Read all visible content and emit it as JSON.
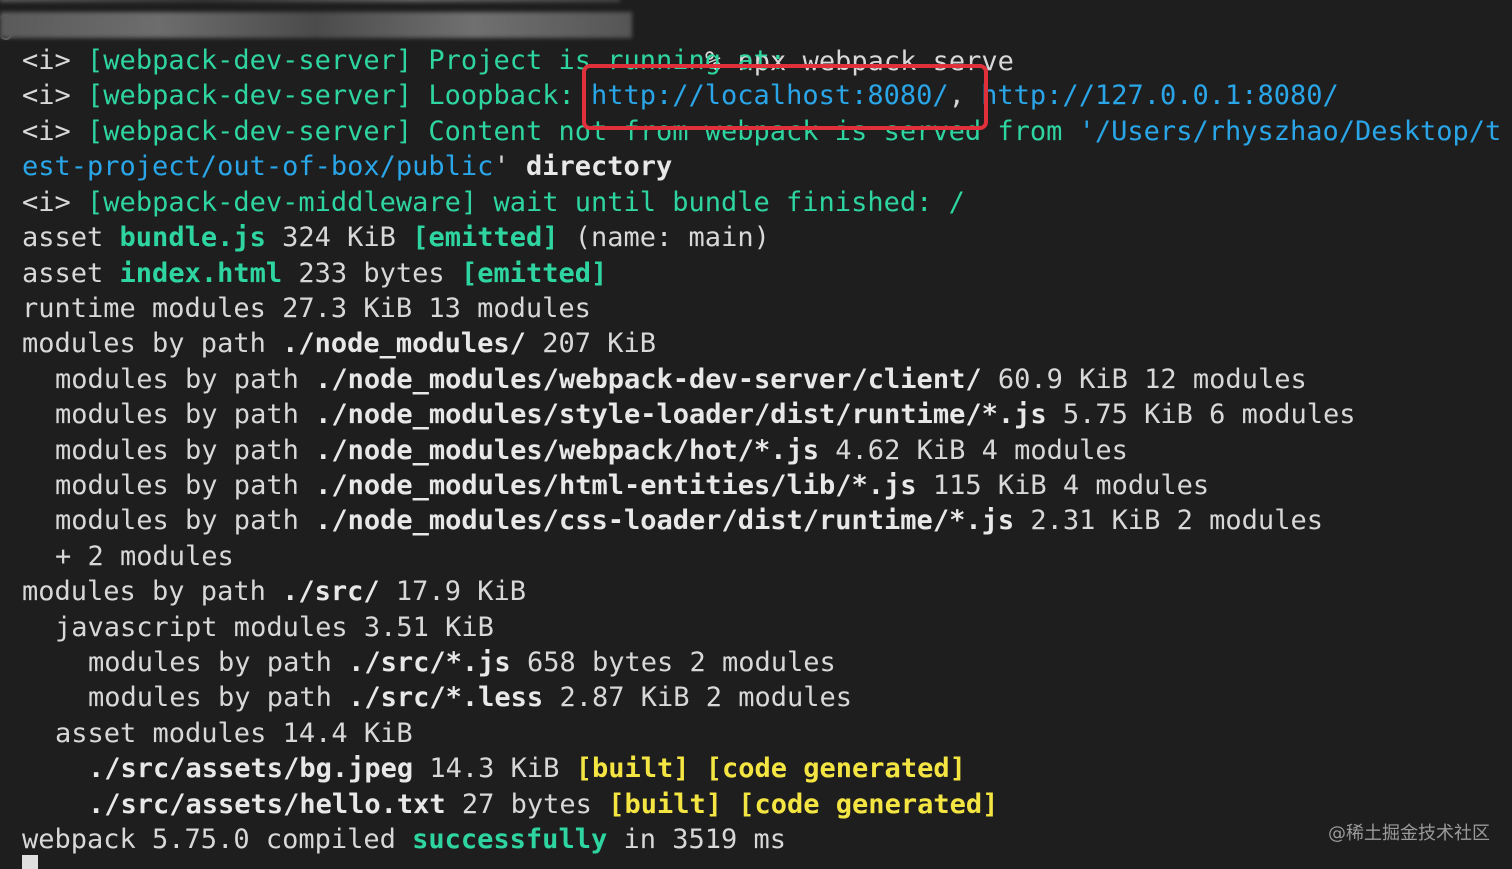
{
  "command": "% npx webpack serve",
  "lines": {
    "l1": {
      "tag": "<i>",
      "src": "[webpack-dev-server]",
      "msg": "Project is running at:"
    },
    "l2": {
      "tag": "<i>",
      "src": "[webpack-dev-server]",
      "msg": "Loopback:",
      "url1": "http://localhost:8080/",
      "sep": ",",
      "url2": "http://127.0.0.1:8080/"
    },
    "l3": {
      "tag": "<i>",
      "src": "[webpack-dev-server]",
      "msg": "Content not from webpack is served from",
      "path_a": "'/Users/rhyszhao/Desktop/t",
      "path_b": "est-project/out-of-box/public",
      "quote": "'",
      "tail": "directory"
    },
    "l4": {
      "tag": "<i>",
      "src": "[webpack-dev-middleware]",
      "msg": "wait until bundle finished: /"
    },
    "l5": {
      "a": "asset",
      "file": "bundle.js",
      "size": "324 KiB",
      "status": "[emitted]",
      "extra": "(name: main)"
    },
    "l6": {
      "a": "asset",
      "file": "index.html",
      "size": "233 bytes",
      "status": "[emitted]"
    },
    "l7": {
      "text": "runtime modules 27.3 KiB 13 modules"
    },
    "l8": {
      "pre": "modules by path",
      "path": "./node_modules/",
      "post": "207 KiB"
    },
    "l9": {
      "pre": "modules by path",
      "path": "./node_modules/webpack-dev-server/client/",
      "post": "60.9 KiB 12 modules"
    },
    "l10": {
      "pre": "modules by path",
      "path": "./node_modules/style-loader/dist/runtime/*.js",
      "post": "5.75 KiB 6 modules"
    },
    "l11": {
      "pre": "modules by path",
      "path": "./node_modules/webpack/hot/*.js",
      "post": "4.62 KiB 4 modules"
    },
    "l12": {
      "pre": "modules by path",
      "path": "./node_modules/html-entities/lib/*.js",
      "post": "115 KiB 4 modules"
    },
    "l13": {
      "pre": "modules by path",
      "path": "./node_modules/css-loader/dist/runtime/*.js",
      "post": "2.31 KiB 2 modules"
    },
    "l14": {
      "text": "+ 2 modules"
    },
    "l15": {
      "pre": "modules by path",
      "path": "./src/",
      "post": "17.9 KiB"
    },
    "l16": {
      "text": "javascript modules 3.51 KiB"
    },
    "l17": {
      "pre": "modules by path",
      "path": "./src/*.js",
      "post": "658 bytes 2 modules"
    },
    "l18": {
      "pre": "modules by path",
      "path": "./src/*.less",
      "post": "2.87 KiB 2 modules"
    },
    "l19": {
      "text": "asset modules 14.4 KiB"
    },
    "l20": {
      "file": "./src/assets/bg.jpeg",
      "size": "14.3 KiB",
      "built": "[built]",
      "gen": "[code generated]"
    },
    "l21": {
      "file": "./src/assets/hello.txt",
      "size": "27 bytes",
      "built": "[built]",
      "gen": "[code generated]"
    },
    "l22": {
      "pre": "webpack 5.75.0 compiled",
      "status": "successfully",
      "post": "in 3519 ms"
    }
  },
  "watermark": "@稀土掘金技术社区",
  "colors": {
    "background": "#1e1e1e",
    "green": "#2ed5a0",
    "blue": "#2aa6e8",
    "yellow": "#f4e542",
    "highlight": "#e0303b"
  }
}
